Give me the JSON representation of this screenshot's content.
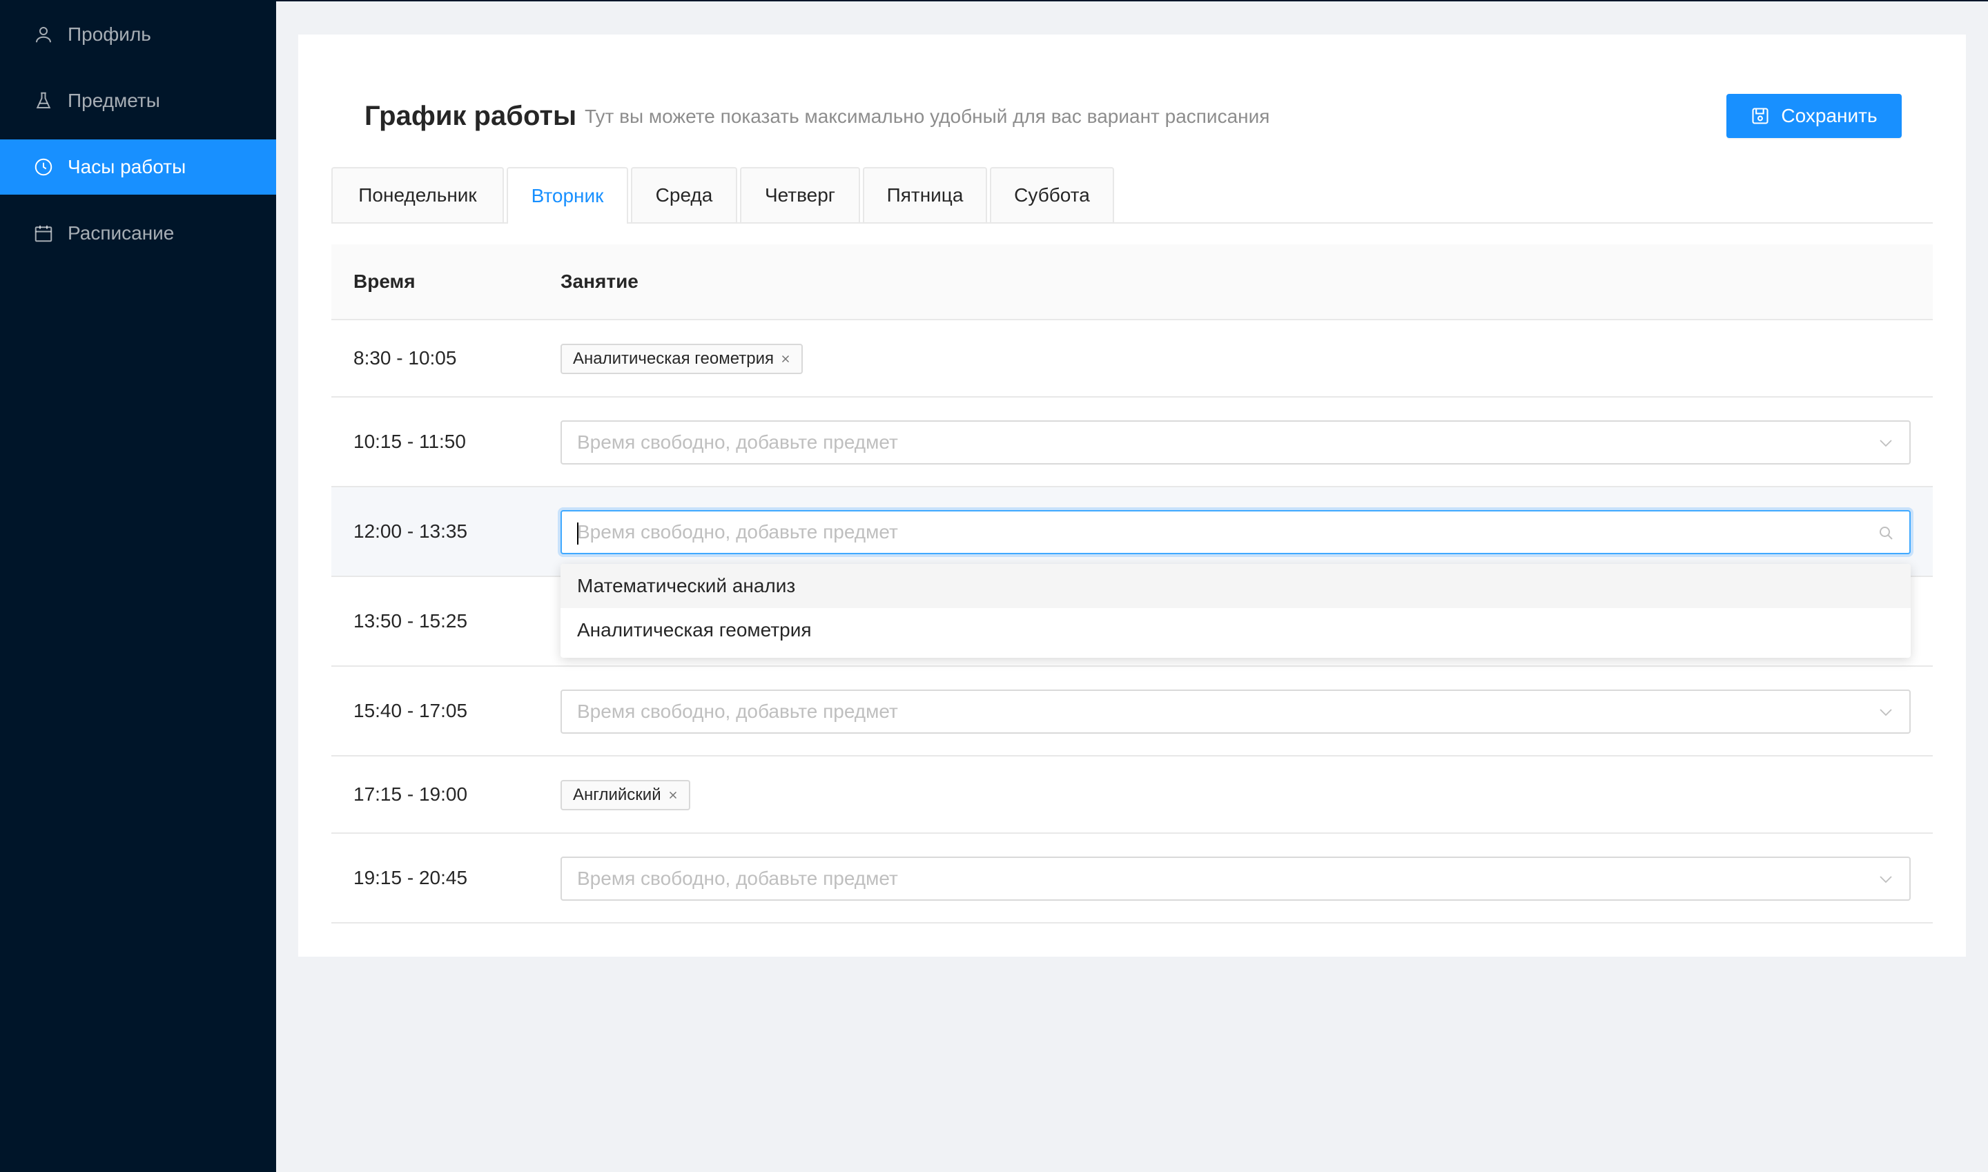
{
  "sidebar": {
    "items": [
      {
        "label": "Профиль",
        "icon": "user-icon"
      },
      {
        "label": "Предметы",
        "icon": "flask-icon"
      },
      {
        "label": "Часы работы",
        "icon": "clock-icon",
        "active": true
      },
      {
        "label": "Расписание",
        "icon": "calendar-icon"
      }
    ]
  },
  "header": {
    "title": "График работы",
    "subtitle": "Тут вы можете показать максимально удобный для вас вариант расписания",
    "save_label": "Сохранить"
  },
  "tabs": [
    {
      "label": "Понедельник"
    },
    {
      "label": "Вторник",
      "active": true
    },
    {
      "label": "Среда"
    },
    {
      "label": "Четверг"
    },
    {
      "label": "Пятница"
    },
    {
      "label": "Суббота"
    }
  ],
  "table": {
    "columns": [
      "Время",
      "Занятие"
    ],
    "placeholder": "Время свободно, добавьте предмет",
    "rows": [
      {
        "time": "8:30 - 10:05",
        "tag": "Аналитическая геометрия"
      },
      {
        "time": "10:15 - 11:50"
      },
      {
        "time": "12:00 - 13:35",
        "focused": true
      },
      {
        "time": "13:50 - 15:25"
      },
      {
        "time": "15:40 - 17:05"
      },
      {
        "time": "17:15 - 19:00",
        "tag": "Английский"
      },
      {
        "time": "19:15 - 20:45"
      }
    ]
  },
  "dropdown": {
    "options": [
      "Математический анализ",
      "Аналитическая геометрия"
    ]
  },
  "colors": {
    "sidebar_bg": "#001529",
    "accent": "#1890ff",
    "page_bg": "#f0f2f5"
  }
}
